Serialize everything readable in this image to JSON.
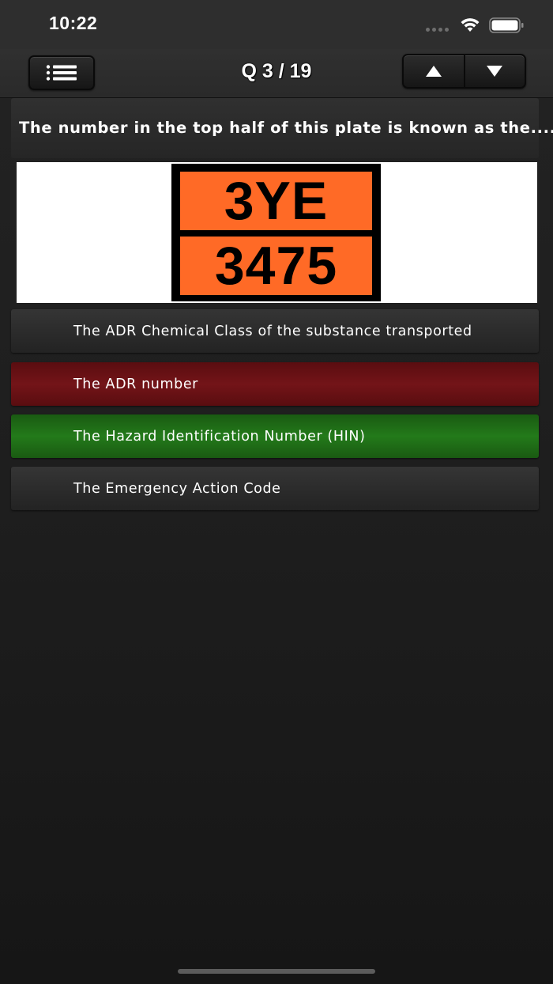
{
  "status_bar": {
    "time": "10:22",
    "wifi_icon": "wifi-icon",
    "battery_icon": "battery-icon",
    "signal_icon": "signal-dots-icon"
  },
  "nav": {
    "menu_icon": "list-icon",
    "title": "Q 3 / 19",
    "prev_icon": "triangle-up-icon",
    "next_icon": "triangle-down-icon"
  },
  "question": {
    "text": "The number in the top half of this plate is known as the....?"
  },
  "plate": {
    "top": "3YE",
    "bottom": "3475",
    "color": "#ff6a26"
  },
  "answers": [
    {
      "label": "The ADR Chemical Class of the substance transported",
      "state": "neutral"
    },
    {
      "label": "The ADR number",
      "state": "wrong"
    },
    {
      "label": "The Hazard Identification Number (HIN)",
      "state": "correct"
    },
    {
      "label": "The Emergency Action Code",
      "state": "neutral"
    }
  ],
  "colors": {
    "wrong": "#731418",
    "correct": "#237a1a",
    "neutral": "#2b2b2b"
  }
}
